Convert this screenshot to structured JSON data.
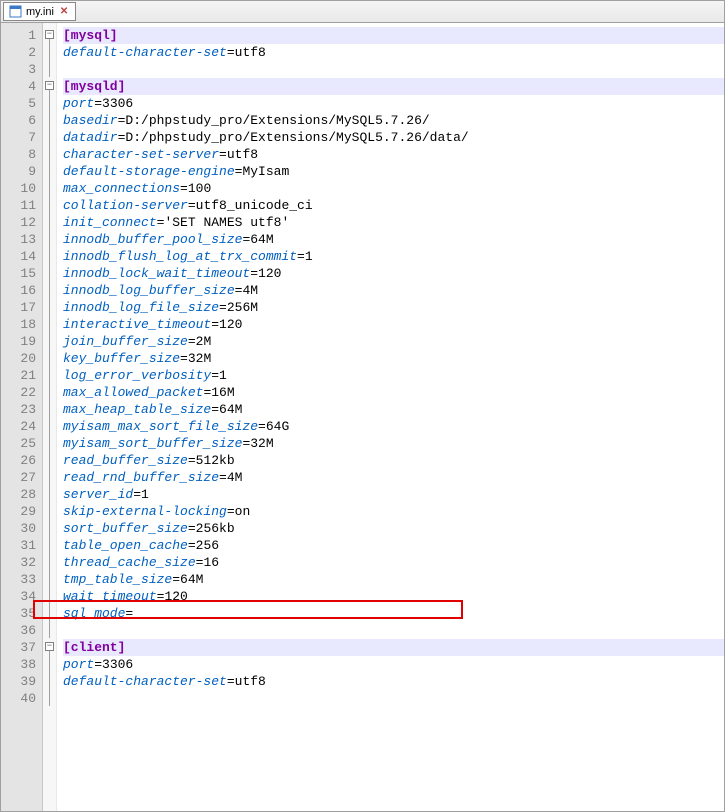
{
  "tab": {
    "filename": "my.ini"
  },
  "syntax": {
    "section_color": "#8000a0",
    "key_color": "#0060c0",
    "val_color": "#000000"
  },
  "highlight": {
    "line": 35
  },
  "lines": [
    {
      "n": 1,
      "type": "section",
      "text": "[mysql]",
      "fold": true,
      "active": true
    },
    {
      "n": 2,
      "type": "kv",
      "key": "default-character-set",
      "val": "utf8"
    },
    {
      "n": 3,
      "type": "blank"
    },
    {
      "n": 4,
      "type": "section",
      "text": "[mysqld]",
      "fold": true,
      "active": true
    },
    {
      "n": 5,
      "type": "kv",
      "key": "port",
      "val": "3306"
    },
    {
      "n": 6,
      "type": "kv",
      "key": "basedir",
      "val": "D:/phpstudy_pro/Extensions/MySQL5.7.26/"
    },
    {
      "n": 7,
      "type": "kv",
      "key": "datadir",
      "val": "D:/phpstudy_pro/Extensions/MySQL5.7.26/data/"
    },
    {
      "n": 8,
      "type": "kv",
      "key": "character-set-server",
      "val": "utf8"
    },
    {
      "n": 9,
      "type": "kv",
      "key": "default-storage-engine",
      "val": "MyIsam"
    },
    {
      "n": 10,
      "type": "kv",
      "key": "max_connections",
      "val": "100"
    },
    {
      "n": 11,
      "type": "kv",
      "key": "collation-server",
      "val": "utf8_unicode_ci"
    },
    {
      "n": 12,
      "type": "kv",
      "key": "init_connect",
      "val": "'SET NAMES utf8'"
    },
    {
      "n": 13,
      "type": "kv",
      "key": "innodb_buffer_pool_size",
      "val": "64M"
    },
    {
      "n": 14,
      "type": "kv",
      "key": "innodb_flush_log_at_trx_commit",
      "val": "1"
    },
    {
      "n": 15,
      "type": "kv",
      "key": "innodb_lock_wait_timeout",
      "val": "120"
    },
    {
      "n": 16,
      "type": "kv",
      "key": "innodb_log_buffer_size",
      "val": "4M"
    },
    {
      "n": 17,
      "type": "kv",
      "key": "innodb_log_file_size",
      "val": "256M"
    },
    {
      "n": 18,
      "type": "kv",
      "key": "interactive_timeout",
      "val": "120"
    },
    {
      "n": 19,
      "type": "kv",
      "key": "join_buffer_size",
      "val": "2M"
    },
    {
      "n": 20,
      "type": "kv",
      "key": "key_buffer_size",
      "val": "32M"
    },
    {
      "n": 21,
      "type": "kv",
      "key": "log_error_verbosity",
      "val": "1"
    },
    {
      "n": 22,
      "type": "kv",
      "key": "max_allowed_packet",
      "val": "16M"
    },
    {
      "n": 23,
      "type": "kv",
      "key": "max_heap_table_size",
      "val": "64M"
    },
    {
      "n": 24,
      "type": "kv",
      "key": "myisam_max_sort_file_size",
      "val": "64G"
    },
    {
      "n": 25,
      "type": "kv",
      "key": "myisam_sort_buffer_size",
      "val": "32M"
    },
    {
      "n": 26,
      "type": "kv",
      "key": "read_buffer_size",
      "val": "512kb"
    },
    {
      "n": 27,
      "type": "kv",
      "key": "read_rnd_buffer_size",
      "val": "4M"
    },
    {
      "n": 28,
      "type": "kv",
      "key": "server_id",
      "val": "1"
    },
    {
      "n": 29,
      "type": "kv",
      "key": "skip-external-locking",
      "val": "on"
    },
    {
      "n": 30,
      "type": "kv",
      "key": "sort_buffer_size",
      "val": "256kb"
    },
    {
      "n": 31,
      "type": "kv",
      "key": "table_open_cache",
      "val": "256"
    },
    {
      "n": 32,
      "type": "kv",
      "key": "thread_cache_size",
      "val": "16"
    },
    {
      "n": 33,
      "type": "kv",
      "key": "tmp_table_size",
      "val": "64M"
    },
    {
      "n": 34,
      "type": "kv",
      "key": "wait_timeout",
      "val": "120"
    },
    {
      "n": 35,
      "type": "kv",
      "key": "sql_mode",
      "val": ""
    },
    {
      "n": 36,
      "type": "blank"
    },
    {
      "n": 37,
      "type": "section",
      "text": "[client]",
      "fold": true,
      "active": true
    },
    {
      "n": 38,
      "type": "kv",
      "key": "port",
      "val": "3306"
    },
    {
      "n": 39,
      "type": "kv",
      "key": "default-character-set",
      "val": "utf8"
    },
    {
      "n": 40,
      "type": "blank"
    }
  ]
}
